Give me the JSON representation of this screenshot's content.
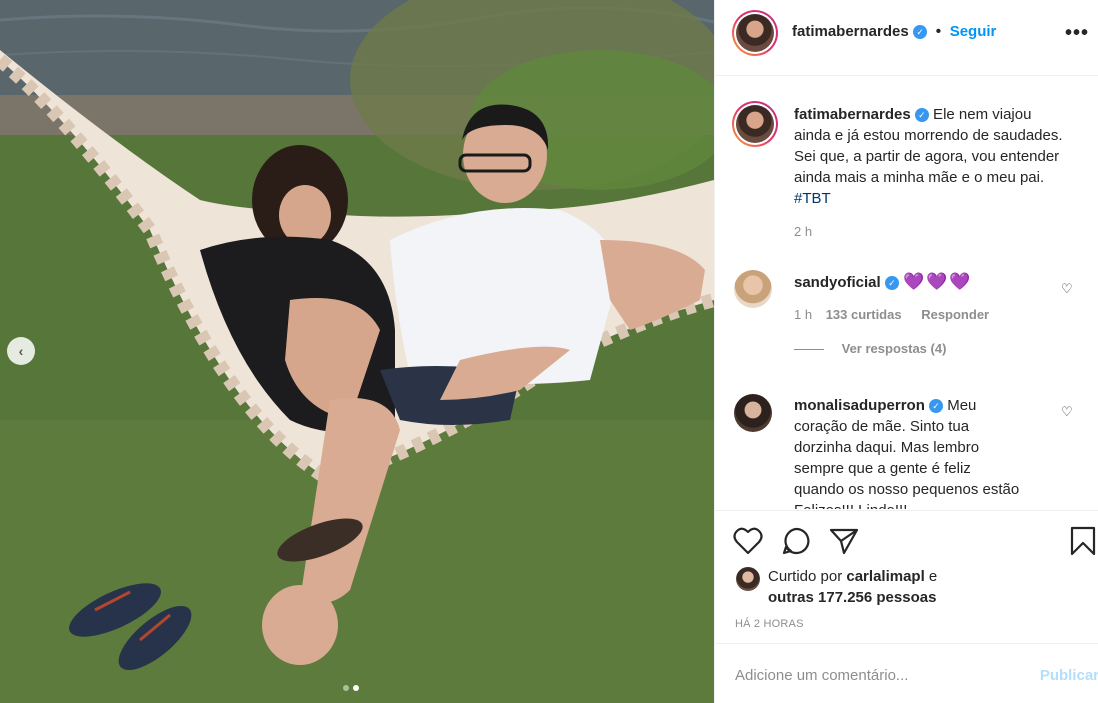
{
  "post": {
    "author": "fatimabernardes",
    "follow_label": "Seguir",
    "more_glyph": "•••",
    "caption_text": " Ele nem viajou ainda e já estou morrendo de saudades. Sei que, a partir de agora, vou entender ainda mais a minha mãe e o meu pai. ",
    "caption_hashtag": "#TBT",
    "caption_time": "2 h",
    "verified_glyph": "✓"
  },
  "comments": [
    {
      "username": "sandyoficial",
      "text": "💜💜💜",
      "time": "1 h",
      "likes": "133 curtidas",
      "reply_label": "Responder",
      "view_replies": "Ver respostas (4)"
    },
    {
      "username": "monalisaduperron",
      "text": " Meu coração de mãe. Sinto tua dorzinha daqui. Mas lembro sempre que a gente é feliz quando os nosso pequenos estão Felizes!!! Lindo!!!"
    }
  ],
  "likes": {
    "prefix": "Curtido por ",
    "user": "carlalimapl",
    "mid": " e",
    "others": "outras 177.256 pessoas"
  },
  "post_time": "HÁ 2 HORAS",
  "comment_box": {
    "placeholder": "Adicione um comentário...",
    "publish_label": "Publicar"
  },
  "carousel": {
    "prev_glyph": "‹",
    "current_slide": 2,
    "total_slides": 2
  },
  "icons": {
    "like": "heart-icon",
    "comment": "comment-icon",
    "share": "share-icon",
    "save": "bookmark-icon"
  },
  "colors": {
    "link_blue": "#0095f6",
    "verified_blue": "#3897f0",
    "hashtag": "#00376b",
    "muted": "#8e8e8e",
    "publish_disabled": "#b2dffc"
  }
}
